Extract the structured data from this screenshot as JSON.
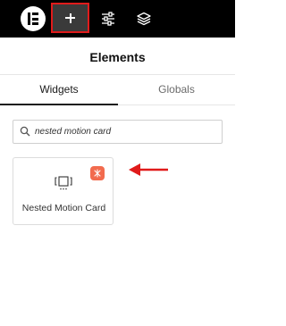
{
  "topbar": {
    "logo_icon": "elementor-logo-icon",
    "add_icon": "plus-icon",
    "settings_icon": "sliders-icon",
    "layers_icon": "layers-icon",
    "highlight_color": "#e01b1b"
  },
  "panel": {
    "title": "Elements"
  },
  "tabs": [
    {
      "label": "Widgets",
      "active": true
    },
    {
      "label": "Globals",
      "active": false
    }
  ],
  "search": {
    "icon": "search-icon",
    "value": "nested motion card"
  },
  "widgets": [
    {
      "label": "Nested Motion Card",
      "icon": "nested-motion-card-icon",
      "badge_icon": "pro-badge-icon",
      "badge_color": "#f26b4e"
    }
  ],
  "annotation": {
    "icon": "red-arrow-icon",
    "color": "#e01b1b"
  }
}
